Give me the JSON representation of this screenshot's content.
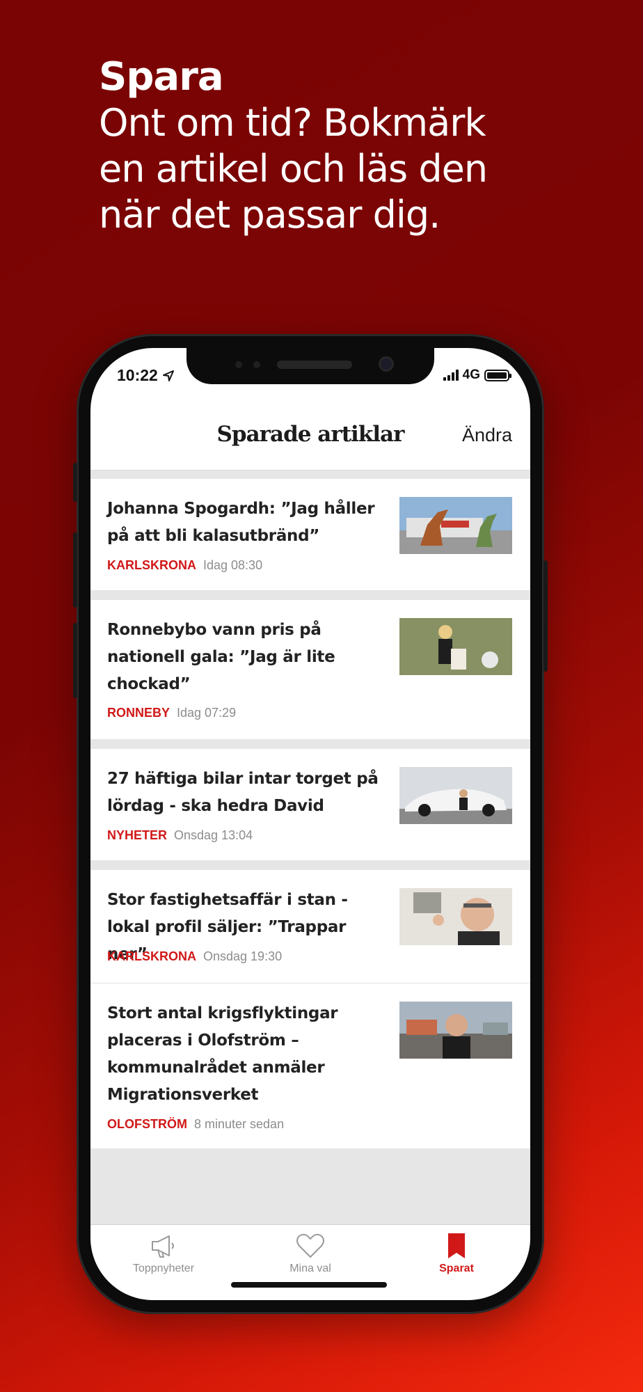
{
  "hero": {
    "title": "Spara",
    "line1": "Ont om tid? Bokmärk",
    "line2": "en artikel och läs den",
    "line3": "när det passar dig."
  },
  "status": {
    "time": "10:22",
    "network": "4G"
  },
  "navbar": {
    "title": "Sparade artiklar",
    "edit": "Ändra"
  },
  "articles": [
    {
      "title": "Johanna Spogardh: ”Jag håller på att bli kalasutbränd”",
      "category": "KARLSKRONA",
      "time": "Idag 08:30"
    },
    {
      "title": "Ronnebybo vann pris på nationell gala: ”Jag är lite chockad”",
      "category": "RONNEBY",
      "time": "Idag 07:29"
    },
    {
      "title": "27 häftiga bilar intar torget på lördag - ska hedra David",
      "category": "NYHETER",
      "time": "Onsdag 13:04"
    },
    {
      "title": "Stor fastighetsaffär i stan - lokal profil säljer: ”Trappar ner”",
      "category": "KARLSKRONA",
      "time": "Onsdag 19:30"
    },
    {
      "title": "Stort antal krigsflyktingar placeras i Olofström – kommunalrådet anmäler Migrationsverket",
      "category": "OLOFSTRÖM",
      "time": "8 minuter sedan"
    }
  ],
  "tabs": [
    {
      "label": "Toppnyheter",
      "icon": "megaphone-icon"
    },
    {
      "label": "Mina val",
      "icon": "heart-icon"
    },
    {
      "label": "Sparat",
      "icon": "bookmark-icon"
    }
  ],
  "colors": {
    "accent": "#d11818",
    "background": "#7a0403"
  }
}
